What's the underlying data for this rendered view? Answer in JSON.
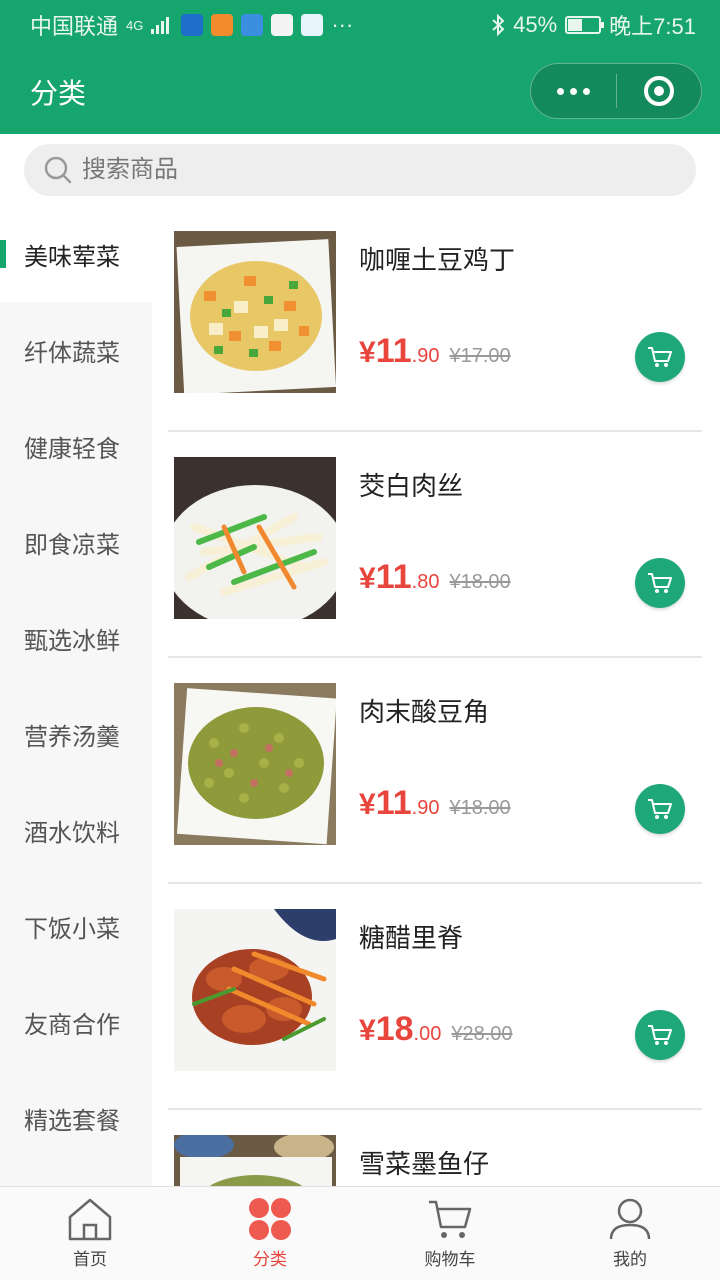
{
  "status_bar": {
    "carrier": "中国联通",
    "network": "4G",
    "battery_text": "45%",
    "battery_level": 0.45,
    "time": "晚上7:51",
    "more": "···"
  },
  "nav": {
    "title": "分类"
  },
  "search": {
    "placeholder": "搜索商品",
    "value": ""
  },
  "categories": [
    {
      "label": "美味荤菜",
      "active": true
    },
    {
      "label": "纤体蔬菜"
    },
    {
      "label": "健康轻食"
    },
    {
      "label": "即食凉菜"
    },
    {
      "label": "甄选冰鲜"
    },
    {
      "label": "营养汤羹"
    },
    {
      "label": "酒水饮料"
    },
    {
      "label": "下饭小菜"
    },
    {
      "label": "友商合作"
    },
    {
      "label": "精选套餐"
    }
  ],
  "products": [
    {
      "name": "咖喱土豆鸡丁",
      "currency": "¥",
      "price_int": "11",
      "price_dec": ".90",
      "orig_price": "¥17.00"
    },
    {
      "name": "茭白肉丝",
      "currency": "¥",
      "price_int": "11",
      "price_dec": ".80",
      "orig_price": "¥18.00"
    },
    {
      "name": "肉末酸豆角",
      "currency": "¥",
      "price_int": "11",
      "price_dec": ".90",
      "orig_price": "¥18.00"
    },
    {
      "name": "糖醋里脊",
      "currency": "¥",
      "price_int": "18",
      "price_dec": ".00",
      "orig_price": "¥28.00"
    },
    {
      "name": "雪菜墨鱼仔"
    }
  ],
  "tabbar": [
    {
      "label": "首页",
      "icon": "home-icon"
    },
    {
      "label": "分类",
      "icon": "category-icon",
      "active": true
    },
    {
      "label": "购物车",
      "icon": "cart-icon"
    },
    {
      "label": "我的",
      "icon": "user-icon"
    }
  ],
  "colors": {
    "brand": "#17a56e",
    "price": "#e8453c",
    "cart_button": "#1ea87a"
  }
}
